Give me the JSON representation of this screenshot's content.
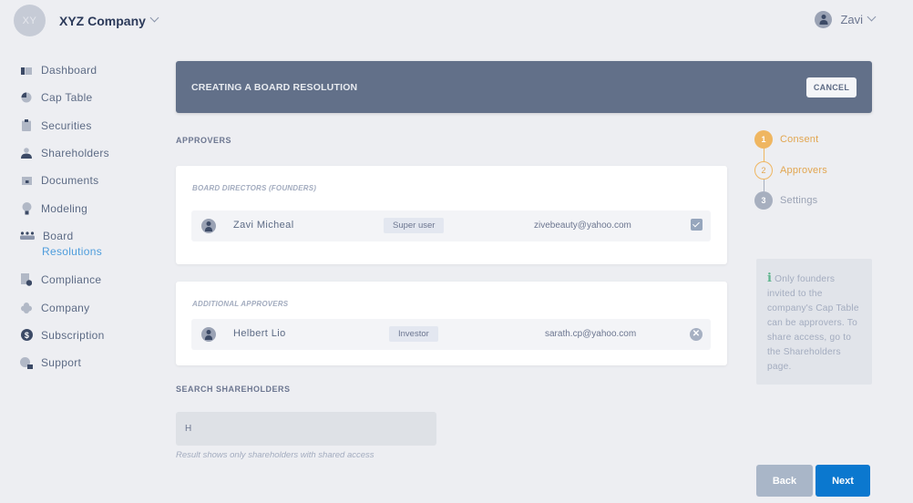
{
  "company": {
    "initials": "XY",
    "name": "XYZ Company"
  },
  "user": {
    "name": "Zavi"
  },
  "sidebar": {
    "items": [
      {
        "label": "Dashboard",
        "icon": "dashboard-icon"
      },
      {
        "label": "Cap Table",
        "icon": "pie-chart-icon"
      },
      {
        "label": "Securities",
        "icon": "clipboard-icon"
      },
      {
        "label": "Shareholders",
        "icon": "person-icon"
      },
      {
        "label": "Documents",
        "icon": "folder-lock-icon"
      },
      {
        "label": "Modeling",
        "icon": "lightbulb-dollar-icon"
      },
      {
        "label": "Board",
        "icon": "board-people-icon"
      },
      {
        "label": "Compliance",
        "icon": "document-check-icon"
      },
      {
        "label": "Company",
        "icon": "flower-icon"
      },
      {
        "label": "Subscription",
        "icon": "dollar-circle-icon"
      },
      {
        "label": "Support",
        "icon": "chat-help-icon"
      }
    ],
    "board_sub": {
      "label": "Resolutions",
      "active": true
    }
  },
  "banner": {
    "title": "CREATING A BOARD RESOLUTION",
    "cancel_label": "CANCEL"
  },
  "approvers": {
    "section_label": "APPROVERS",
    "board_directors": {
      "label": "BOARD DIRECTORS (FOUNDERS)",
      "rows": [
        {
          "name": "Zavi Micheal",
          "role": "Super user",
          "email": "zivebeauty@yahoo.com",
          "checked": true
        }
      ]
    },
    "additional": {
      "label": "ADDITIONAL APPROVERS",
      "rows": [
        {
          "name": "Helbert Lio",
          "role": "Investor",
          "email": "sarath.cp@yahoo.com",
          "remove_symbol": "✕"
        }
      ]
    }
  },
  "stepper": {
    "steps": [
      {
        "number": "1",
        "label": "Consent",
        "state": "done"
      },
      {
        "number": "2",
        "label": "Approvers",
        "state": "active"
      },
      {
        "number": "3",
        "label": "Settings",
        "state": "todo"
      }
    ],
    "colors": {
      "done": "#efb661",
      "todo": "#a7afbf"
    }
  },
  "info": {
    "icon": "i",
    "text": "Only founders invited to the company's Cap Table can be approvers. To share access, go to the Shareholders page."
  },
  "search": {
    "label": "SEARCH SHAREHOLDERS",
    "value": "H",
    "hint": "Result shows only shareholders with shared access"
  },
  "footer": {
    "back_label": "Back",
    "next_label": "Next"
  },
  "colors": {
    "primary": "#0b78cf",
    "banner": "#627089",
    "accent": "#efb661",
    "link": "#4f9ddc"
  }
}
